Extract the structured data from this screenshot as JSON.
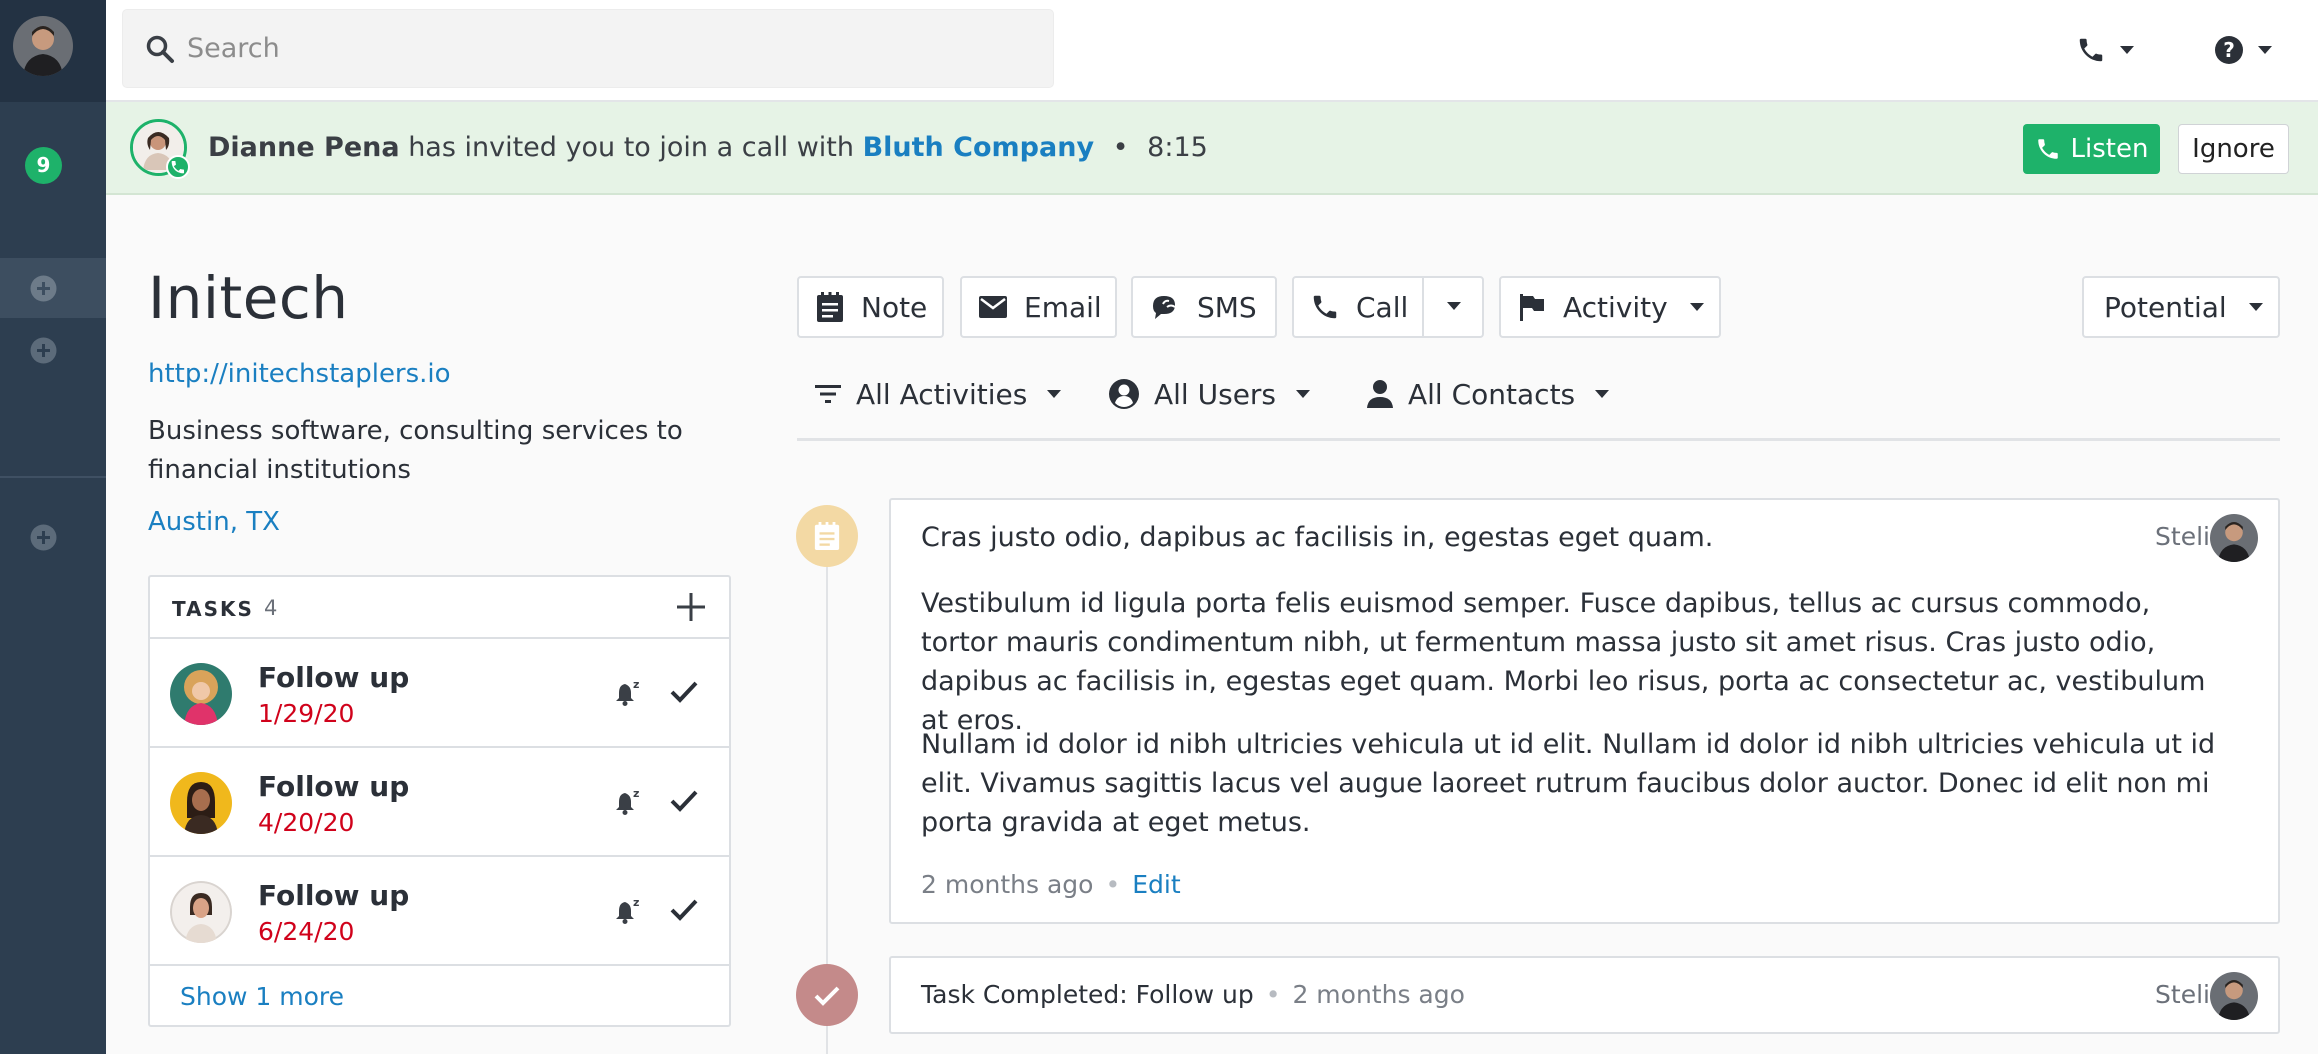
{
  "search": {
    "placeholder": "Search"
  },
  "sidebar": {
    "badge": "9"
  },
  "banner": {
    "caller": "Dianne Pena",
    "message": "has invited you to join a call with",
    "company": "Bluth Company",
    "separator": "•",
    "duration": "8:15",
    "listen_label": "Listen",
    "ignore_label": "Ignore"
  },
  "lead": {
    "name": "Initech",
    "url": "http://initechstaplers.io",
    "description": "Business software, consulting services to financial institutions",
    "location": "Austin, TX"
  },
  "tasks": {
    "title": "TASKS",
    "count": "4",
    "items": [
      {
        "title": "Follow up",
        "date": "1/29/20"
      },
      {
        "title": "Follow up",
        "date": "4/20/20"
      },
      {
        "title": "Follow up",
        "date": "6/24/20"
      }
    ],
    "show_more": "Show 1 more"
  },
  "actions": {
    "note": "Note",
    "email": "Email",
    "sms": "SMS",
    "call": "Call",
    "activity": "Activity",
    "status": "Potential"
  },
  "filters": {
    "activities": "All Activities",
    "users": "All Users",
    "contacts": "All Contacts"
  },
  "timeline": {
    "note": {
      "title": "Cras justo odio, dapibus ac facilisis in, egestas eget quam.",
      "paragraph1": "Vestibulum id ligula porta felis euismod semper. Fusce dapibus, tellus ac cursus commodo, tortor mauris condimentum nibh, ut fermentum massa justo sit amet risus. Cras justo odio, dapibus ac facilisis in, egestas eget quam. Morbi leo risus, porta ac consectetur ac, vestibulum at eros.",
      "paragraph2": "Nullam id dolor id nibh ultricies vehicula ut id elit. Nullam id dolor id nibh ultricies vehicula ut id elit. Vivamus sagittis lacus vel augue laoreet rutrum faucibus dolor auctor. Donec id elit non mi porta gravida at eget metus.",
      "user": "Steli",
      "time": "2 months ago",
      "separator": "•",
      "edit_label": "Edit"
    },
    "task": {
      "text": "Task Completed: Follow up",
      "separator": "•",
      "time": "2 months ago",
      "user": "Steli"
    }
  },
  "colors": {
    "sidebar": "#2d3e50",
    "accent_green": "#1eb26a",
    "link_blue": "#1a7fc1",
    "overdue_red": "#d0021b",
    "note_dot": "#f3d9a4",
    "task_dot": "#c48a8a"
  }
}
